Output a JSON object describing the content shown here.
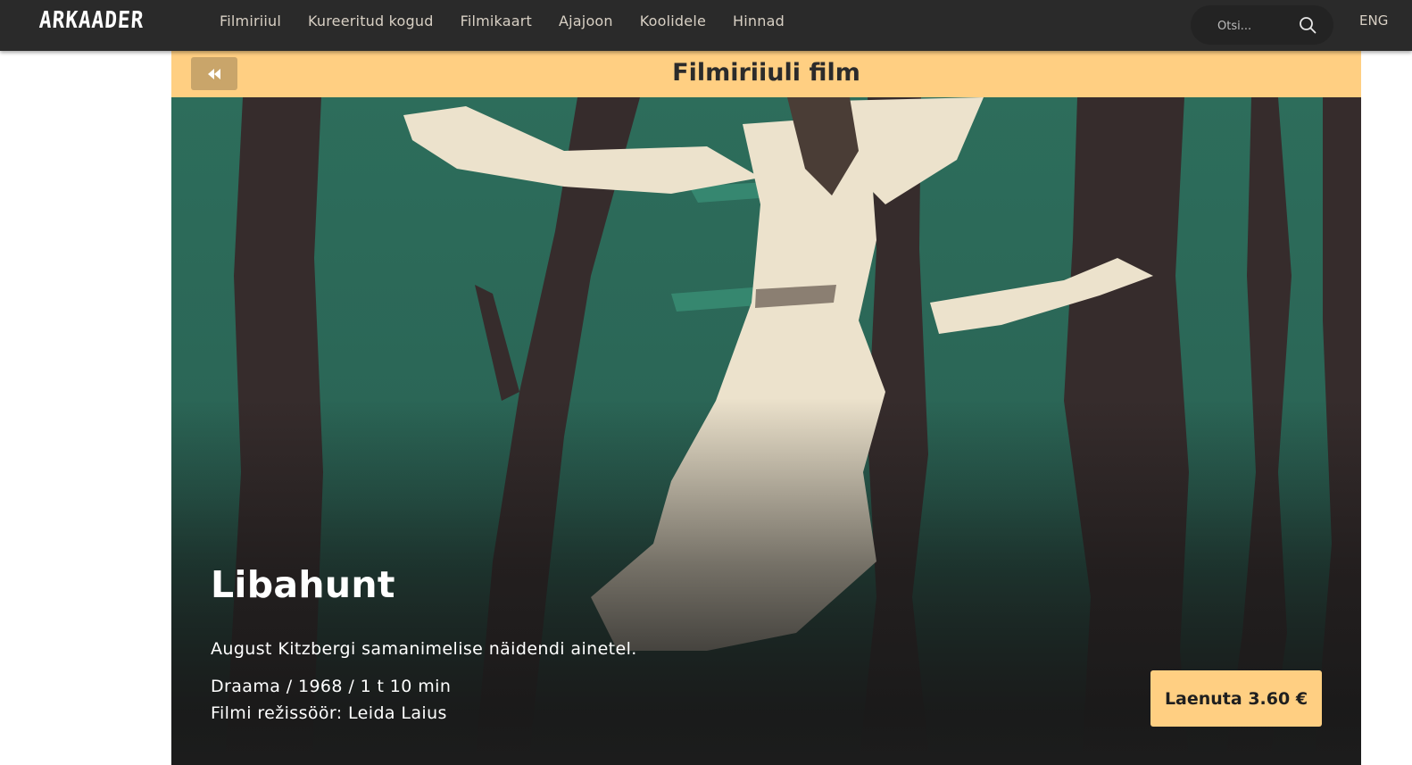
{
  "header": {
    "logo": "ARKAADER",
    "nav": [
      "Filmiriiul",
      "Kureeritud kogud",
      "Filmikaart",
      "Ajajoon",
      "Koolidele",
      "Hinnad"
    ],
    "search_placeholder": "Otsi...",
    "language": "ENG"
  },
  "banner": {
    "title": "Filmiriiuli film",
    "back_icon": "rewind-icon"
  },
  "film": {
    "title": "Libahunt",
    "description": "August Kitzbergi samanimelise näidendi ainetel.",
    "meta": "Draama / 1968 / 1 t 10 min",
    "director": "Filmi režissöör: Leida Laius",
    "rent_label": "Laenuta 3.60 €"
  },
  "colors": {
    "topbar": "#2a2a2a",
    "accent": "#ffcf82",
    "poster_green": "#2c6a59",
    "tree_dark": "#362c2c",
    "dress": "#ece2cc"
  },
  "icons": {
    "search": "search-icon",
    "back": "rewind-icon"
  }
}
